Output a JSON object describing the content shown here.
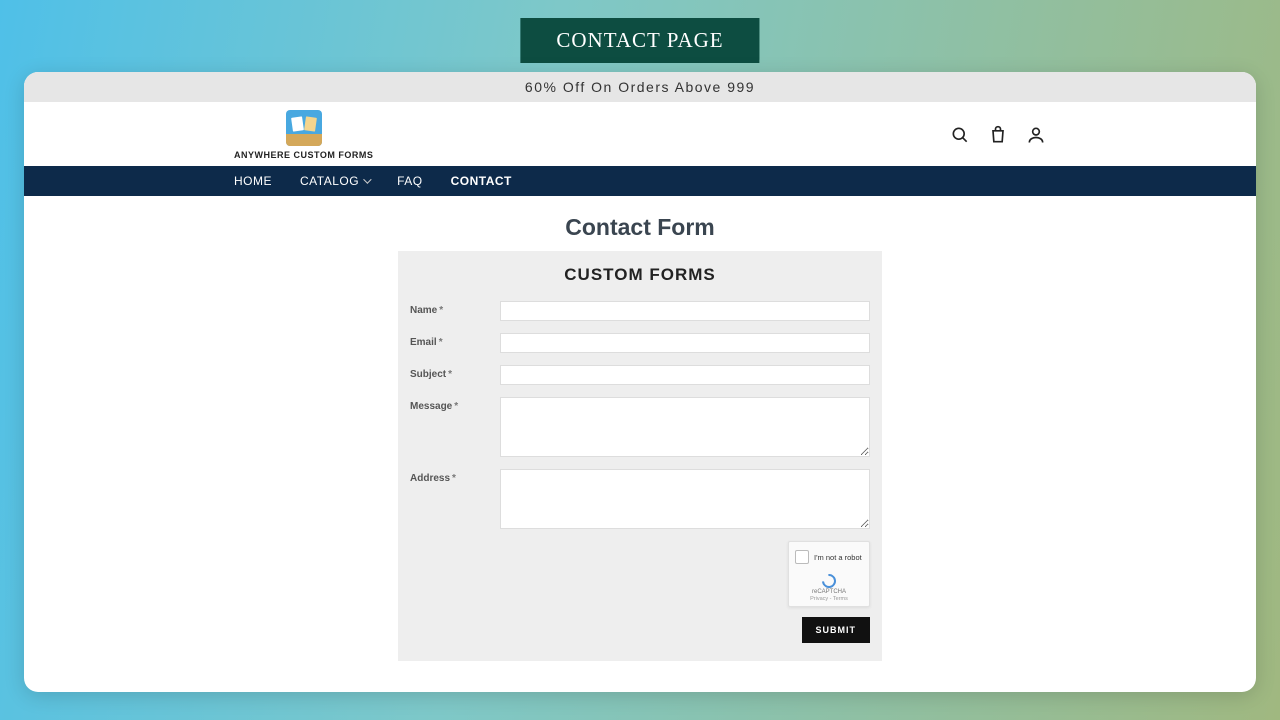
{
  "ribbon": {
    "title": "CONTACT PAGE"
  },
  "promo": {
    "text": "60% Off On Orders Above 999"
  },
  "logo": {
    "text": "ANYWHERE CUSTOM FORMS"
  },
  "nav": {
    "items": [
      {
        "label": "HOME",
        "active": false,
        "dropdown": false
      },
      {
        "label": "CATALOG",
        "active": false,
        "dropdown": true
      },
      {
        "label": "FAQ",
        "active": false,
        "dropdown": false
      },
      {
        "label": "CONTACT",
        "active": true,
        "dropdown": false
      }
    ]
  },
  "page": {
    "title": "Contact Form"
  },
  "form": {
    "heading": "CUSTOM FORMS",
    "fields": [
      {
        "label": "Name",
        "required": true,
        "type": "text"
      },
      {
        "label": "Email",
        "required": true,
        "type": "text"
      },
      {
        "label": "Subject",
        "required": true,
        "type": "text"
      },
      {
        "label": "Message",
        "required": true,
        "type": "textarea"
      },
      {
        "label": "Address",
        "required": true,
        "type": "textarea"
      }
    ],
    "captcha": {
      "label": "I'm not a robot",
      "brand": "reCAPTCHA",
      "links": "Privacy - Terms"
    },
    "submit": "SUBMIT"
  }
}
